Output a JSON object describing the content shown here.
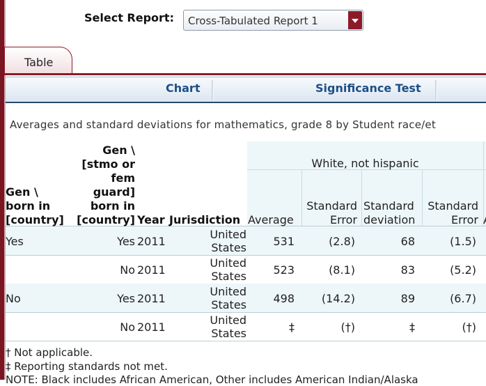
{
  "selector": {
    "label": "Select Report:",
    "value": "Cross-Tabulated Report 1"
  },
  "tabs": [
    "Table"
  ],
  "toolbar": {
    "chart": "Chart",
    "significance": "Significance Test"
  },
  "description": "Averages and standard deviations for mathematics, grade 8 by Student race/et",
  "table": {
    "headers": {
      "gen_born_country": "Gen \\ born in [country]",
      "gen_stmo_line1": "Gen \\",
      "gen_stmo_line2": "[stmo or",
      "gen_stmo_line3": "fem",
      "gen_stmo_line4": "guard]",
      "gen_stmo_line5": "born in",
      "gen_stmo_line6": "[country]",
      "gen_born_line1": "Gen \\",
      "gen_born_line2": "born in",
      "gen_born_line3": "[country]",
      "year": "Year",
      "jurisdiction": "Jurisdiction",
      "group": "White, not hispanic",
      "average": "Average",
      "se1_line1": "Standard",
      "se1_line2": "Error",
      "sd_line1": "Standard",
      "sd_line2": "deviation",
      "se2_line1": "Standard",
      "se2_line2": "Error",
      "cut": "A"
    },
    "rows": [
      {
        "gen": "Yes",
        "gen2": "Yes",
        "year": "2011",
        "jur1": "United",
        "jur2": "States",
        "avg": "531",
        "se": "(2.8)",
        "sd": "68",
        "sdse": "(1.5)"
      },
      {
        "gen": "",
        "gen2": "No",
        "year": "2011",
        "jur1": "United",
        "jur2": "States",
        "avg": "523",
        "se": "(8.1)",
        "sd": "83",
        "sdse": "(5.2)"
      },
      {
        "gen": "No",
        "gen2": "Yes",
        "year": "2011",
        "jur1": "United",
        "jur2": "States",
        "avg": "498",
        "se": "(14.2)",
        "sd": "89",
        "sdse": "(6.7)"
      },
      {
        "gen": "",
        "gen2": "No",
        "year": "2011",
        "jur1": "United",
        "jur2": "States",
        "avg": "‡",
        "se": "(†)",
        "sd": "‡",
        "sdse": "(†)"
      }
    ]
  },
  "footnotes": {
    "na": "† Not applicable.",
    "rs": "‡ Reporting standards not met.",
    "note": "NOTE: Black includes African American, Other includes American Indian/Alaska"
  }
}
